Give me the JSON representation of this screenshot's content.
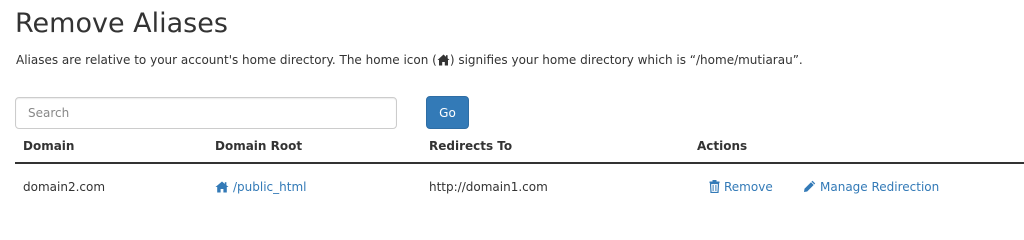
{
  "page": {
    "title": "Remove Aliases",
    "description_prefix": "Aliases are relative to your account's home directory. The home icon (",
    "description_suffix": ") signifies your home directory which is “/home/mutiarau”.",
    "home_icon": "home-icon"
  },
  "search": {
    "placeholder": "Search",
    "value": "",
    "go_label": "Go"
  },
  "table": {
    "headers": {
      "domain": "Domain",
      "domain_root": "Domain Root",
      "redirects_to": "Redirects To",
      "actions": "Actions"
    },
    "rows": [
      {
        "domain": "domain2.com",
        "domain_root": "/public_html",
        "domain_root_icon": "home-icon",
        "redirects_to": "http://domain1.com",
        "remove_label": "Remove",
        "remove_icon": "trash-icon",
        "manage_label": "Manage Redirection",
        "manage_icon": "pencil-icon"
      }
    ]
  },
  "colors": {
    "text": "#333333",
    "link": "#337ab7",
    "button": "#337ab7",
    "border": "#cccccc"
  }
}
